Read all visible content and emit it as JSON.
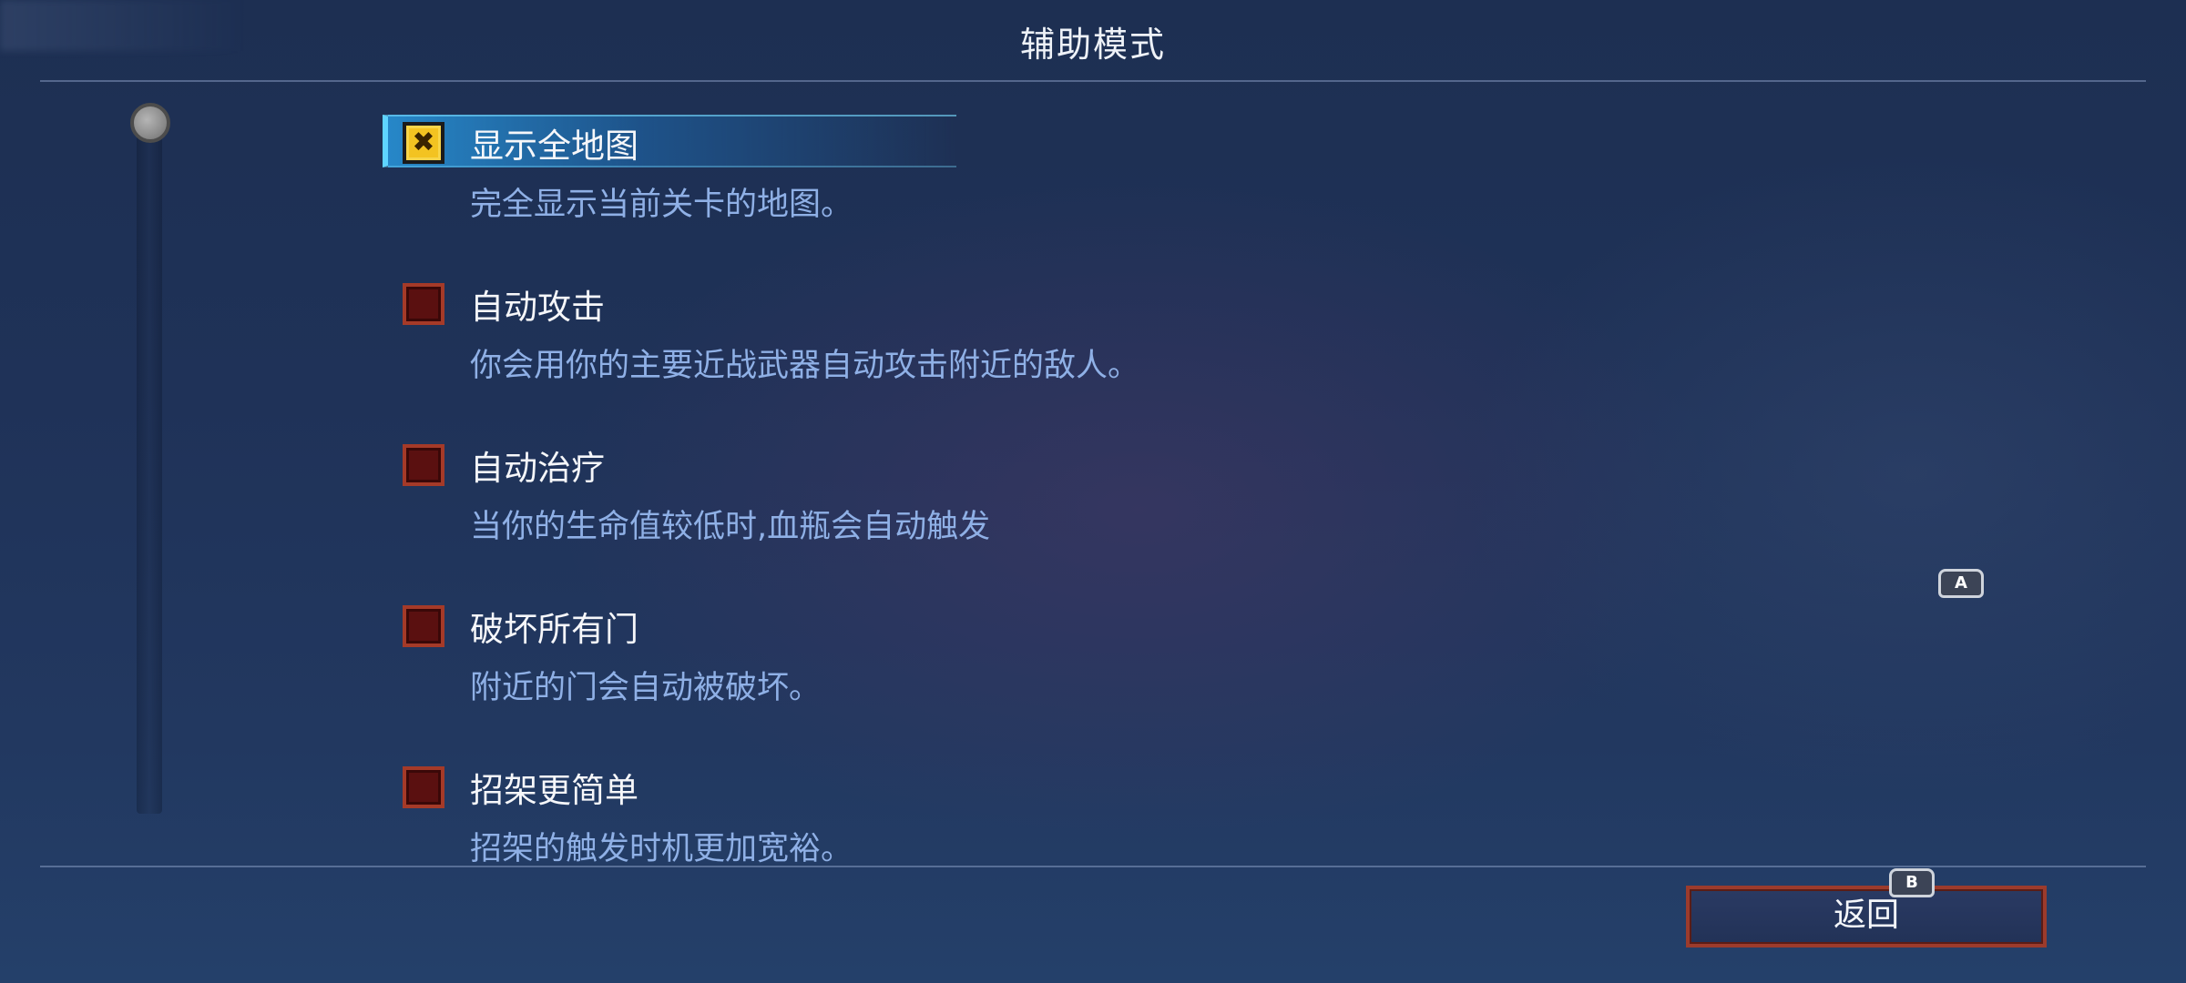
{
  "header": {
    "title": "辅助模式"
  },
  "options": [
    {
      "label": "显示全地图",
      "description": "完全显示当前关卡的地图。",
      "checked": true,
      "selected": true
    },
    {
      "label": "自动攻击",
      "description": "你会用你的主要近战武器自动攻击附近的敌人。",
      "checked": false,
      "selected": false
    },
    {
      "label": "自动治疗",
      "description": "当你的生命值较低时,血瓶会自动触发",
      "checked": false,
      "selected": false
    },
    {
      "label": "破坏所有门",
      "description": "附近的门会自动被破坏。",
      "checked": false,
      "selected": false
    },
    {
      "label": "招架更简单",
      "description": "招架的触发时机更加宽裕。",
      "checked": false,
      "selected": false
    }
  ],
  "checkmark_glyph": "✖",
  "hints": {
    "a_key": "A",
    "b_key": "B"
  },
  "footer": {
    "back_label": "返回"
  },
  "colors": {
    "checkbox_checked": "#f3c321",
    "checkbox_unchecked": "#5a1010",
    "checkbox_border": "#a53a28",
    "highlight": "#2896dc",
    "description_text": "#8fb0e6"
  }
}
